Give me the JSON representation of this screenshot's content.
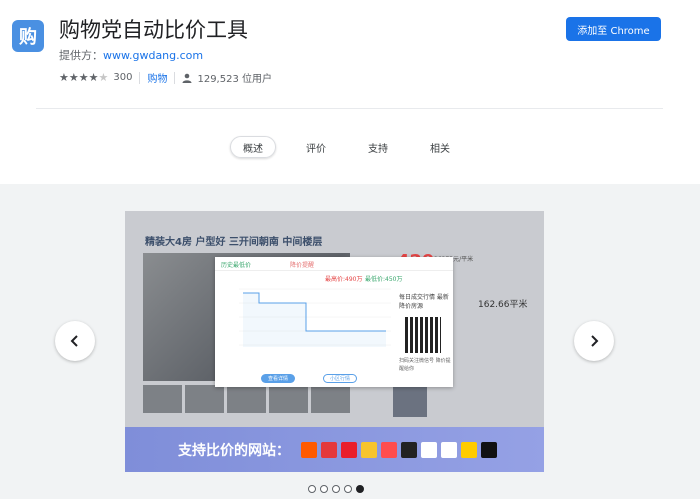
{
  "header": {
    "icon_char": "购",
    "title": "购物党自动比价工具",
    "provider_label": "提供方：",
    "provider_link": "www.gwdang.com",
    "rating": 3.5,
    "rating_count": "300",
    "category": "购物",
    "users": "129,523 位用户",
    "add_button": "添加至 Chrome"
  },
  "tabs": [
    {
      "label": "概述",
      "active": true
    },
    {
      "label": "评价",
      "active": false
    },
    {
      "label": "支持",
      "active": false
    },
    {
      "label": "相关",
      "active": false
    }
  ],
  "gallery": {
    "listing_title": "精装大4房 户型好 三开间朝南 中间楼层",
    "price": "429",
    "unit_price": "26375元/平米",
    "area": "162.66平米",
    "popup": {
      "tab_history": "历史最低价",
      "tab_alert": "降价提醒",
      "highest": "最高价:490万",
      "lowest": "最低价:450万",
      "qr_text": "每日成交行情 最新降价房源",
      "qr_caption": "扫码关注微信号 降价提醒给你",
      "btn_a": "查看详情",
      "btn_b": "小区行情"
    },
    "banner_text": "支持比价的网站：",
    "active_slide": 5,
    "slide_count": 5
  },
  "icons": {
    "prev": "chevron-left-icon",
    "next": "chevron-right-icon",
    "user": "user-icon",
    "star": "star-icon"
  },
  "colors": {
    "accent": "#1a73e8",
    "banner": "#8d99e0",
    "price": "#e54646"
  }
}
